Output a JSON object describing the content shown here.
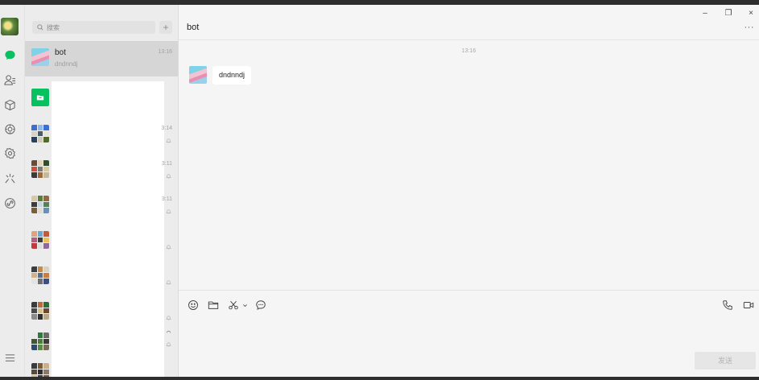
{
  "sidebar": {
    "icons": [
      "chat-bubble-icon",
      "contacts-icon",
      "box-icon",
      "settings-gear-icon",
      "plugin-gear-icon",
      "sparkle-icon",
      "link-icon",
      "menu-icon"
    ],
    "active_color": "#07c160"
  },
  "search": {
    "placeholder": "搜索"
  },
  "chat_list": [
    {
      "title": "bot",
      "preview": "dndnndj",
      "time": "13:16",
      "active": true
    },
    {
      "title": "",
      "preview": "",
      "time": "",
      "avatar": "green-folder"
    },
    {
      "title": "",
      "preview": "",
      "time": "3:14",
      "avatar": "group"
    },
    {
      "title": "",
      "preview": "",
      "time": "3:11",
      "avatar": "group"
    },
    {
      "title": "",
      "preview": "",
      "time": "3:11",
      "avatar": "group"
    },
    {
      "title": "",
      "preview": "",
      "time": "",
      "avatar": "group"
    },
    {
      "title": "",
      "preview": "",
      "time": "",
      "avatar": "group"
    },
    {
      "title": "",
      "preview": "",
      "time": "",
      "avatar": "group"
    },
    {
      "title": "",
      "preview": "",
      "time": "",
      "avatar": "group"
    },
    {
      "title": "",
      "preview": "",
      "time": "",
      "avatar": "group"
    }
  ],
  "chat": {
    "title": "bot",
    "timestamp": "13:16",
    "messages": [
      {
        "text": "dndnndj",
        "sender": "bot"
      }
    ],
    "send_label": "发送"
  },
  "window": {
    "minimize": "–",
    "restore": "❐",
    "close": "×",
    "more": "···"
  }
}
